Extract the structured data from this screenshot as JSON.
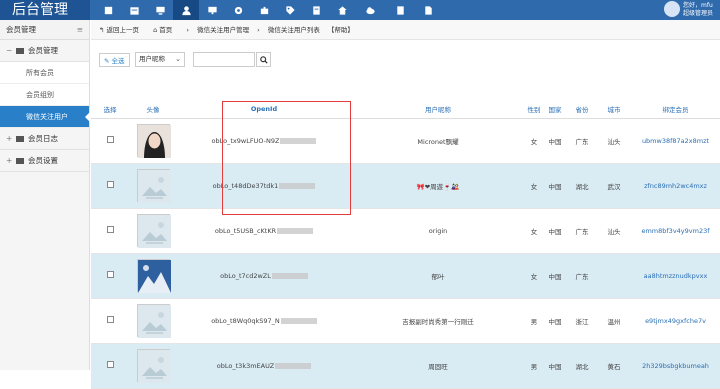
{
  "app": {
    "title": "后台管理"
  },
  "user": {
    "greeting": "您好，mfu",
    "role": "超级管理员"
  },
  "topnav": {
    "icons": [
      "home-icon",
      "calendar-icon",
      "user-icon",
      "monitor-icon",
      "gear-icon",
      "puzzle-icon",
      "tag-icon",
      "house-icon",
      "cloud-upload-icon",
      "clipboard-icon",
      "document-icon"
    ],
    "active_index": 3
  },
  "sidebar": {
    "header": "会员管理",
    "groups": [
      {
        "label": "会员管理",
        "expanded": true,
        "items": [
          "所有会员",
          "会员组别",
          "微信关注用户"
        ],
        "active_item": 2
      },
      {
        "label": "会员日志",
        "expanded": false
      },
      {
        "label": "会员设置",
        "expanded": false
      }
    ]
  },
  "breadcrumb": {
    "back": "返回上一页",
    "home": "首页",
    "section": "微信关注用户管理",
    "page": "微信关注用户列表",
    "help": "【帮助】"
  },
  "toolbar": {
    "select_all": "全选",
    "filter_select": "用户昵称",
    "search_placeholder": ""
  },
  "table": {
    "headers": [
      "选择",
      "头像",
      "OpenId",
      "用户昵称",
      "性别",
      "国家",
      "省份",
      "城市",
      "绑定会员"
    ],
    "rows": [
      {
        "openid": "obLo_tx9wLFUO-N9Z",
        "nickname": "Micronet飘耀",
        "gender": "女",
        "country": "中国",
        "province": "广东",
        "city": "汕头",
        "member": "ubmw38f87a2x8mzt",
        "avatar": "photo-girl"
      },
      {
        "openid": "obLo_t48dDe37tdk1",
        "nickname": "🎀❤周遊🍷🎎",
        "gender": "女",
        "country": "中国",
        "province": "湖北",
        "city": "武汉",
        "member": "zfnc89mh2wc4mxz",
        "avatar": "placeholder"
      },
      {
        "openid": "obLo_t5USB_cKtKR",
        "nickname": "origin",
        "gender": "女",
        "country": "中国",
        "province": "广东",
        "city": "汕头",
        "member": "emm8bf3v4y9vm23f",
        "avatar": "placeholder"
      },
      {
        "openid": "obLo_t7cd2wZL",
        "nickname": "郁叶",
        "gender": "女",
        "country": "中国",
        "province": "广东",
        "city": "",
        "member": "aa8htmzznudkpvxx",
        "avatar": "photo-snow"
      },
      {
        "openid": "obLo_t8Wq0qkS97_N",
        "nickname": "吉报副时尚秀第一行刚迁",
        "gender": "男",
        "country": "中国",
        "province": "浙江",
        "city": "温州",
        "member": "e9tjmx49gxfche7v",
        "avatar": "placeholder"
      },
      {
        "openid": "obLo_t3k3mEAUZ",
        "nickname": "周固旺",
        "gender": "男",
        "country": "中国",
        "province": "湖北",
        "city": "黄石",
        "member": "2h329bsbgkbumeah",
        "avatar": "placeholder"
      }
    ]
  },
  "colors": {
    "topbar": "#2f6aad",
    "brand": "#1e5493",
    "accent": "#2a80c8",
    "alt_row": "#d9ebf3",
    "highlight_box": "#e23c3c"
  }
}
